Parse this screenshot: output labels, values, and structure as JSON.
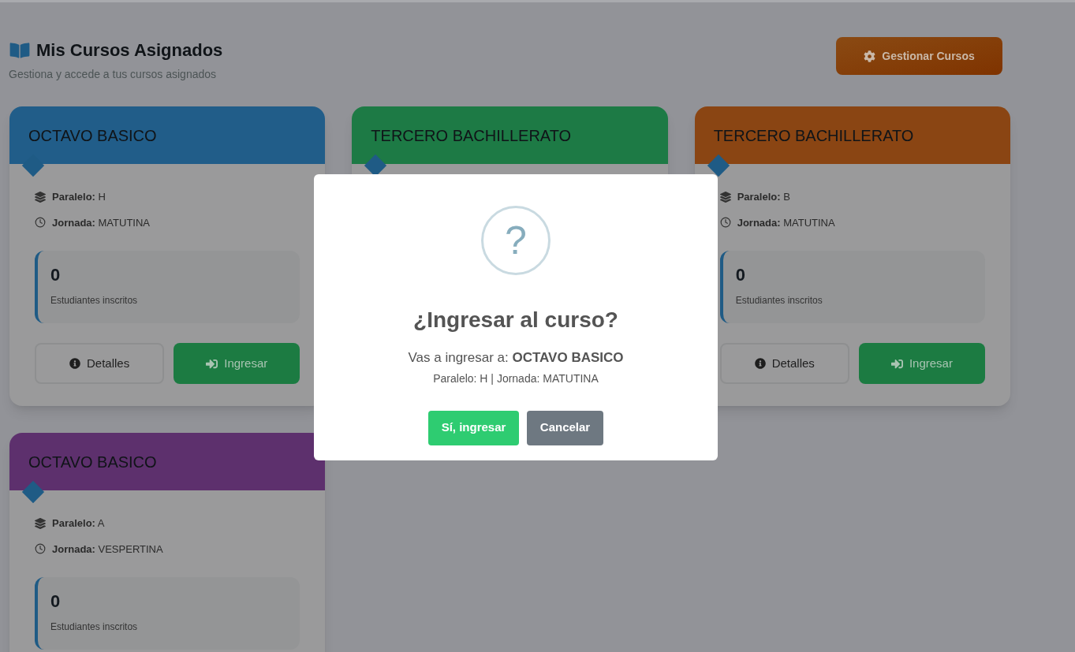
{
  "page": {
    "title": "Mis Cursos Asignados",
    "subtitle": "Gestiona y accede a tus cursos asignados",
    "manage_button": "Gestionar Cursos"
  },
  "cards": [
    {
      "title": "OCTAVO BASICO",
      "color": "#215d89",
      "paralelo_label": "Paralelo:",
      "paralelo": "H",
      "jornada_label": "Jornada:",
      "jornada": "MATUTINA",
      "count": "0",
      "count_label": "Estudiantes inscritos",
      "buttons": [
        {
          "kind": "details",
          "label": "Detalles"
        },
        {
          "kind": "enter",
          "label": "Ingresar"
        }
      ]
    },
    {
      "title": "TERCERO BACHILLERATO",
      "color": "#1d7a45"
    },
    {
      "title": "TERCERO BACHILLERATO",
      "color": "#8a4513",
      "paralelo_label": "Paralelo:",
      "paralelo": "B",
      "jornada_label": "Jornada:",
      "jornada": "MATUTINA",
      "count": "0",
      "count_label": "Estudiantes inscritos",
      "buttons": [
        {
          "kind": "details",
          "label": "Detalles"
        },
        {
          "kind": "enter",
          "label": "Ingresar"
        }
      ]
    },
    {
      "title": "OCTAVO BASICO",
      "color": "#5d306d",
      "paralelo_label": "Paralelo:",
      "paralelo": "A",
      "jornada_label": "Jornada:",
      "jornada": "VESPERTINA",
      "count": "0",
      "count_label": "Estudiantes inscritos"
    }
  ],
  "dialog": {
    "icon_text": "?",
    "title": "¿Ingresar al curso?",
    "message": "Vas a ingresar a: **OCTAVO BASICO**",
    "detail": "Paralelo: H | Jornada: MATUTINA",
    "confirm": "Sí, ingresar",
    "cancel": "Cancelar"
  }
}
